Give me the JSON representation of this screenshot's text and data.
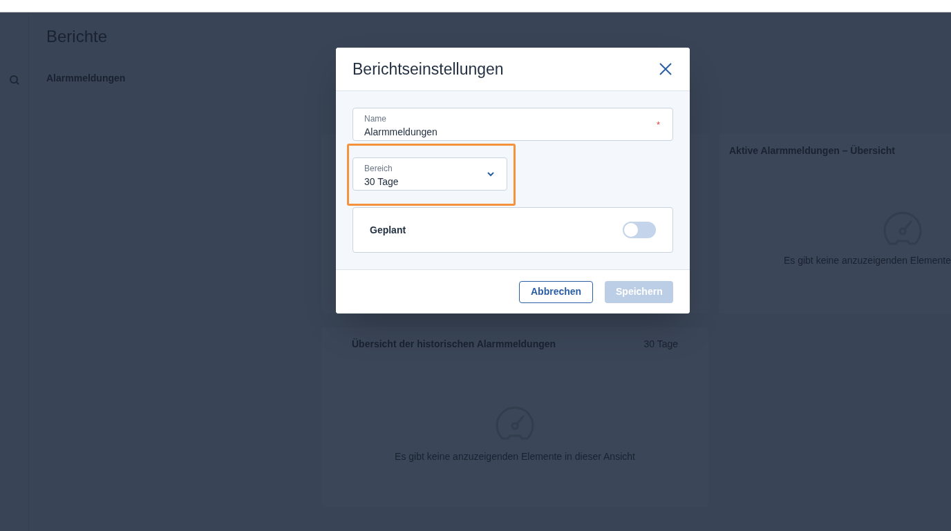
{
  "page": {
    "title": "Berichte",
    "section": "Alarmmeldungen"
  },
  "widgets": [
    {
      "title": "Aktive Alarmmeldungen – Übersicht",
      "empty_text": "Es gibt keine anzuzeigenden Elemente"
    },
    {
      "title": "Übersicht der historischen Alarmmeldungen",
      "range": "30 Tage",
      "empty_text": "Es gibt keine anzuzeigenden Elemente in dieser Ansicht"
    }
  ],
  "dialog": {
    "title": "Berichtseinstellungen",
    "fields": [
      {
        "kind": "text",
        "label": "Name",
        "value": "Alarmmeldungen",
        "required_mark": "*",
        "highlighted": false
      },
      {
        "kind": "select",
        "label": "Bereich",
        "value": "30 Tage",
        "highlighted": true
      }
    ],
    "toggle": {
      "label": "Geplant",
      "on": false
    },
    "buttons": [
      {
        "label": "Abbrechen",
        "kind": "secondary",
        "disabled": false
      },
      {
        "label": "Speichern",
        "kind": "primary",
        "disabled": true
      }
    ]
  }
}
